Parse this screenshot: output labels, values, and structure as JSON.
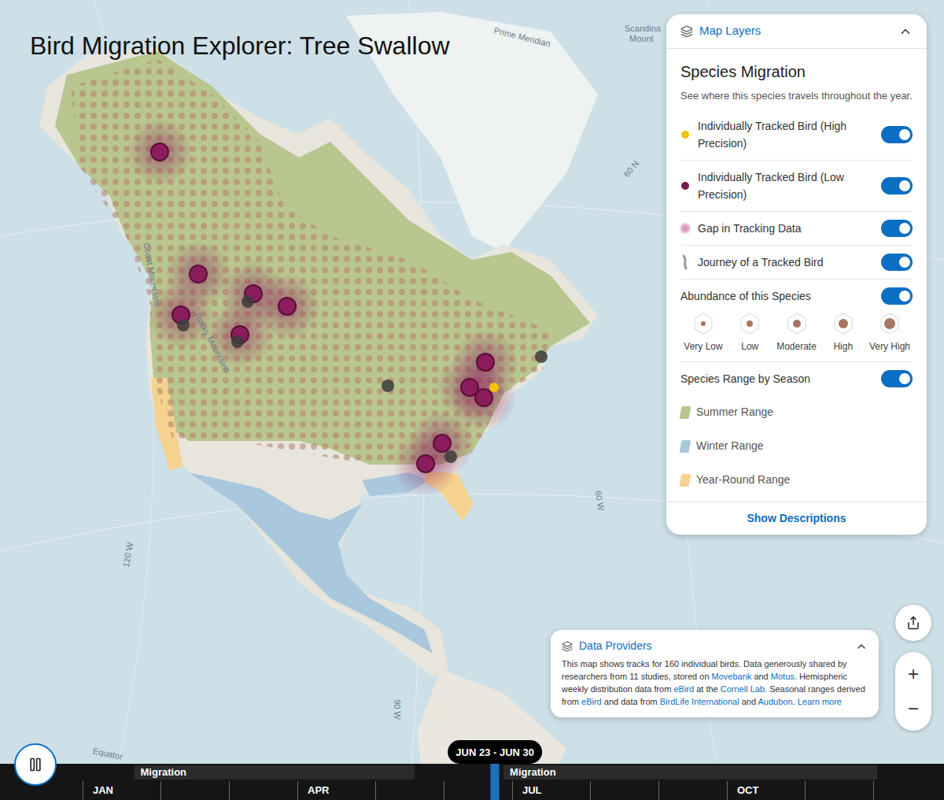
{
  "title": "Bird Migration Explorer: Tree Swallow",
  "map_labels": [
    "Prime Meridian",
    "Scandina",
    "Mount",
    "60 N",
    "Coast Mountains",
    "Rocky Mountains",
    "120 W",
    "90 W",
    "60 W",
    "Equator"
  ],
  "pins": [
    {
      "kind": "low",
      "color": "#8c1d5c"
    },
    {
      "kind": "low",
      "color": "#8c1d5c"
    },
    {
      "kind": "low",
      "color": "#8c1d5c"
    },
    {
      "kind": "low",
      "color": "#8c1d5c"
    },
    {
      "kind": "low",
      "color": "#8c1d5c"
    },
    {
      "kind": "low",
      "color": "#8c1d5c"
    },
    {
      "kind": "low",
      "color": "#8c1d5c"
    },
    {
      "kind": "low",
      "color": "#8c1d5c"
    },
    {
      "kind": "low",
      "color": "#8c1d5c"
    },
    {
      "kind": "low",
      "color": "#8c1d5c"
    },
    {
      "kind": "low",
      "color": "#8c1d5c"
    },
    {
      "kind": "gap",
      "color": "#3d3b3c"
    },
    {
      "kind": "gap",
      "color": "#3d3b3c"
    },
    {
      "kind": "gap",
      "color": "#3d3b3c"
    },
    {
      "kind": "gap",
      "color": "#3d3b3c"
    },
    {
      "kind": "gap",
      "color": "#3d3b3c"
    },
    {
      "kind": "gap",
      "color": "#3d3b3c"
    },
    {
      "kind": "high",
      "color": "#f2c500"
    }
  ],
  "layers_panel": {
    "header": "Map Layers",
    "expanded": true,
    "section_title": "Species Migration",
    "description": "See where this species travels throughout the year.",
    "layers": [
      {
        "label": "Individually Tracked Bird (High Precision)",
        "kind": "dot",
        "color": "#f2c500",
        "on": true
      },
      {
        "label": "Individually Tracked Bird (Low Precision)",
        "kind": "dot",
        "color": "#7a1850",
        "on": true
      },
      {
        "label": "Gap in Tracking Data",
        "kind": "blur",
        "color": "#d99bbd",
        "on": true
      },
      {
        "label": "Journey of a Tracked Bird",
        "kind": "line",
        "color": "#9a9a9a",
        "on": true
      }
    ],
    "abundance": {
      "label": "Abundance of this Species",
      "on": true,
      "levels": [
        {
          "label": "Very Low",
          "level": 0.2
        },
        {
          "label": "Low",
          "level": 0.4
        },
        {
          "label": "Moderate",
          "level": 0.6
        },
        {
          "label": "High",
          "level": 0.8
        },
        {
          "label": "Very High",
          "level": 1
        }
      ]
    },
    "range": {
      "label": "Species Range by Season",
      "on": true,
      "items": [
        {
          "label": "Summer Range",
          "color": "#b9c68f"
        },
        {
          "label": "Winter Range",
          "color": "#a9c7dd"
        },
        {
          "label": "Year-Round Range",
          "color": "#f5d28f"
        }
      ]
    },
    "link": "Show Descriptions"
  },
  "data_providers": {
    "header": "Data Providers",
    "expanded": true,
    "segments": [
      {
        "text": "This map shows tracks for 160 individual birds. Data generously shared by researchers from 11 studies, stored on ",
        "link": false
      },
      {
        "text": "Movebank",
        "link": true
      },
      {
        "text": " and ",
        "link": false
      },
      {
        "text": "Motus",
        "link": true
      },
      {
        "text": ". Hemispheric weekly distribution data from ",
        "link": false
      },
      {
        "text": "eBird",
        "link": true
      },
      {
        "text": " at the ",
        "link": false
      },
      {
        "text": "Cornell Lab",
        "link": true
      },
      {
        "text": ". Seasonal ranges derived from ",
        "link": false
      },
      {
        "text": "eBird",
        "link": true
      },
      {
        "text": " and data from ",
        "link": false
      },
      {
        "text": "BirdLife International",
        "link": true
      },
      {
        "text": " and ",
        "link": false
      },
      {
        "text": "Audubon",
        "link": true
      },
      {
        "text": ". ",
        "link": false
      },
      {
        "text": "Learn more",
        "link": true
      }
    ]
  },
  "zoom": {
    "in": "+",
    "out": "−"
  },
  "timeline": {
    "playing": true,
    "date": "JUN 23 - JUN 30",
    "level": 0.48,
    "seasons": [
      {
        "label": "Migration",
        "start": 0.06,
        "end": 0.386
      },
      {
        "label": "Migration",
        "start": 0.49,
        "end": 0.925
      }
    ],
    "months": [
      "JAN",
      "APR",
      "JUL",
      "OCT"
    ]
  }
}
